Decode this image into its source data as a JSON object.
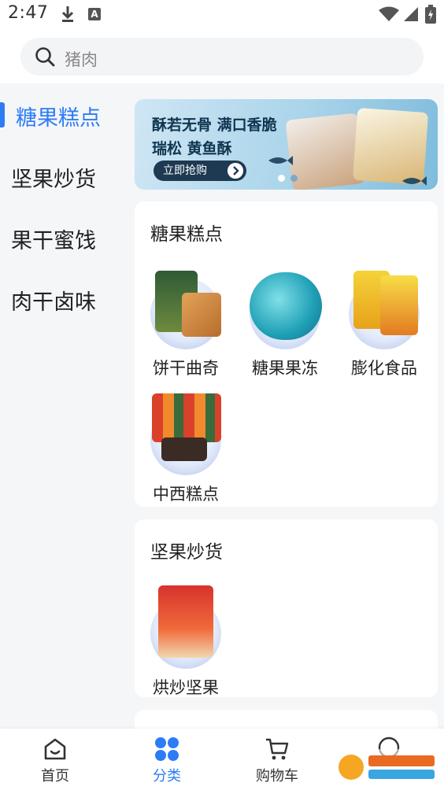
{
  "status_bar": {
    "time": "2:47",
    "a_badge": "A"
  },
  "search": {
    "query": "猪肉"
  },
  "sidebar": {
    "items": [
      {
        "label": "糖果糕点",
        "active": true
      },
      {
        "label": "坚果炒货",
        "active": false
      },
      {
        "label": "果干蜜饯",
        "active": false
      },
      {
        "label": "肉干卤味",
        "active": false
      }
    ]
  },
  "banner": {
    "line1": "酥若无骨 满口香脆",
    "line2": "瑞松 黄鱼酥",
    "button": "立即抢购"
  },
  "sections": [
    {
      "title": "糖果糕点",
      "products": [
        {
          "label": "饼干曲奇"
        },
        {
          "label": "糖果果冻"
        },
        {
          "label": "膨化食品"
        },
        {
          "label": "中西糕点"
        }
      ]
    },
    {
      "title": "坚果炒货",
      "products": [
        {
          "label": "烘炒坚果"
        }
      ]
    }
  ],
  "bottom_nav": {
    "items": [
      {
        "label": "首页",
        "icon": "home-icon",
        "active": false
      },
      {
        "label": "分类",
        "icon": "category-icon",
        "active": true
      },
      {
        "label": "购物车",
        "icon": "cart-icon",
        "active": false
      }
    ]
  },
  "colors": {
    "accent": "#2d7cf6",
    "background": "#f5f6f8"
  }
}
